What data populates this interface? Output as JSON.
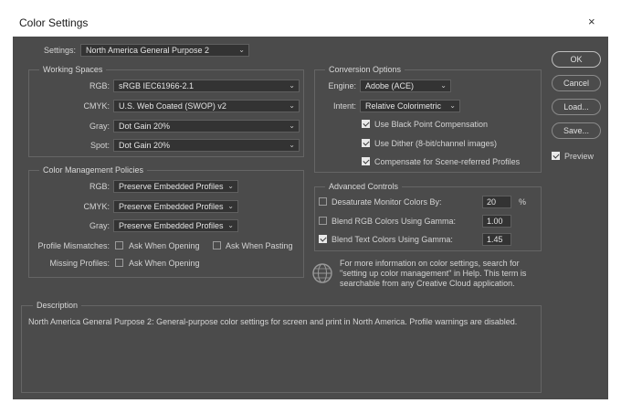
{
  "window": {
    "title": "Color Settings",
    "close_glyph": "×"
  },
  "settings": {
    "label": "Settings:",
    "value": "North America General Purpose 2"
  },
  "working_spaces": {
    "legend": "Working Spaces",
    "rgb": {
      "label": "RGB:",
      "value": "sRGB IEC61966-2.1"
    },
    "cmyk": {
      "label": "CMYK:",
      "value": "U.S. Web Coated (SWOP) v2"
    },
    "gray": {
      "label": "Gray:",
      "value": "Dot Gain 20%"
    },
    "spot": {
      "label": "Spot:",
      "value": "Dot Gain 20%"
    }
  },
  "policies": {
    "legend": "Color Management Policies",
    "rgb": {
      "label": "RGB:",
      "value": "Preserve Embedded Profiles"
    },
    "cmyk": {
      "label": "CMYK:",
      "value": "Preserve Embedded Profiles"
    },
    "gray": {
      "label": "Gray:",
      "value": "Preserve Embedded Profiles"
    },
    "profile_mismatches": {
      "label": "Profile Mismatches:",
      "ask_opening": "Ask When Opening",
      "ask_pasting": "Ask When Pasting"
    },
    "missing_profiles": {
      "label": "Missing Profiles:",
      "ask_opening": "Ask When Opening"
    }
  },
  "conversion": {
    "legend": "Conversion Options",
    "engine": {
      "label": "Engine:",
      "value": "Adobe (ACE)"
    },
    "intent": {
      "label": "Intent:",
      "value": "Relative Colorimetric"
    },
    "black_point": "Use Black Point Compensation",
    "dither": "Use Dither (8-bit/channel images)",
    "scene_referred": "Compensate for Scene-referred Profiles"
  },
  "advanced": {
    "legend": "Advanced Controls",
    "desaturate": {
      "label": "Desaturate Monitor Colors By:",
      "value": "20",
      "unit": "%"
    },
    "blend_rgb": {
      "label": "Blend RGB Colors Using Gamma:",
      "value": "1.00"
    },
    "blend_text": {
      "label": "Blend Text Colors Using Gamma:",
      "value": "1.45"
    }
  },
  "info_text": "For more information on color settings, search for \"setting up color management\" in Help. This term is searchable from any Creative Cloud application.",
  "description": {
    "legend": "Description",
    "text": "North America General Purpose 2:  General-purpose color settings for screen and print in North America. Profile warnings are disabled."
  },
  "buttons": {
    "ok": "OK",
    "cancel": "Cancel",
    "load": "Load...",
    "save": "Save...",
    "preview": "Preview"
  },
  "chevron": "⌄"
}
